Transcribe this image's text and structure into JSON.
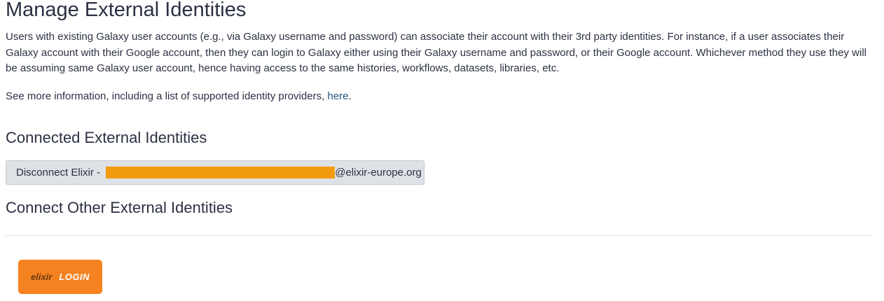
{
  "page": {
    "title": "Manage External Identities",
    "description": "Users with existing Galaxy user accounts (e.g., via Galaxy username and password) can associate their account with their 3rd party identities. For instance, if a user associates their Galaxy account with their Google account, then they can login to Galaxy either using their Galaxy username and password, or their Google account. Whichever method they use they will be assuming same Galaxy user account, hence having access to the same histories, workflows, datasets, libraries, etc.",
    "more_info_prefix": "See more information, including a list of supported identity providers, ",
    "more_info_link": "here",
    "more_info_suffix": "."
  },
  "connected": {
    "heading": "Connected External Identities",
    "disconnect_prefix": "Disconnect Elixir - ",
    "disconnect_suffix": "@elixir-europe.org",
    "redaction_color": "#f29b0f"
  },
  "connect_other": {
    "heading": "Connect Other External Identities",
    "elixir_logo_text": "elixir",
    "elixir_login_label": "LOGIN",
    "button_color": "#f58220"
  }
}
